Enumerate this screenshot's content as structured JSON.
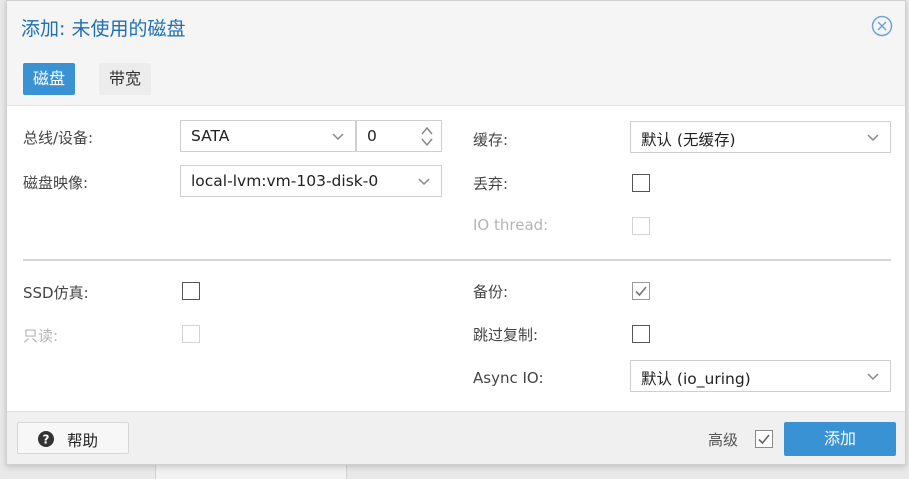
{
  "dialog": {
    "title": "添加: 未使用的磁盘",
    "close_icon": "close-circle-icon"
  },
  "tabs": [
    {
      "label": "磁盘",
      "active": true
    },
    {
      "label": "带宽",
      "active": false
    }
  ],
  "disk": {
    "bus_label": "总线/设备:",
    "bus_value": "SATA",
    "device_value": "0",
    "image_label": "磁盘映像:",
    "image_value": "local-lvm:vm-103-disk-0",
    "cache_label": "缓存:",
    "cache_value": "默认 (无缓存)",
    "discard_label": "丢弃:",
    "discard_checked": false,
    "iothread_label": "IO thread:",
    "iothread_checked": false,
    "iothread_disabled": true
  },
  "advanced": {
    "ssd_label": "SSD仿真:",
    "ssd_checked": false,
    "readonly_label": "只读:",
    "readonly_checked": false,
    "readonly_disabled": true,
    "backup_label": "备份:",
    "backup_checked": true,
    "skip_replication_label": "跳过复制:",
    "skip_replication_checked": false,
    "async_io_label": "Async IO:",
    "async_io_value": "默认 (io_uring)"
  },
  "footer": {
    "help_label": "帮助",
    "help_icon": "question-circle-icon",
    "advanced_label": "高级",
    "advanced_checked": true,
    "add_label": "添加"
  },
  "colors": {
    "accent": "#3892d4",
    "title": "#1e6fb3",
    "disabled": "#b5b5b5"
  }
}
